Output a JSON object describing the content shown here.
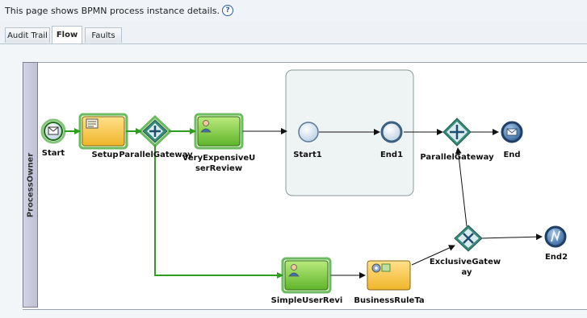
{
  "page": {
    "info_text": "This page shows BPMN process instance details.",
    "help_glyph": "?"
  },
  "tabs": [
    {
      "label": "Audit Trail"
    },
    {
      "label": "Flow"
    },
    {
      "label": "Faults"
    }
  ],
  "active_tab": "Flow",
  "lane": {
    "label": "ProcessOwner"
  },
  "nodes": {
    "start": "Start",
    "setup": "Setup",
    "parallel_gateway_1": "ParallelGateway",
    "very_expensive_line1": "VeryExpensiveU",
    "very_expensive_line2": "serReview",
    "start1": "Start1",
    "end1": "End1",
    "parallel_gateway_2": "ParallelGateway",
    "end": "End",
    "exclusive_line1": "ExclusiveGatew",
    "exclusive_line2": "ay",
    "end2": "End2",
    "simple_user_review": "SimpleUserRevi",
    "business_rule_task": "BusinessRuleTa"
  },
  "colors": {
    "active_path": "#2f9e1f",
    "task_green": "#8fd14f",
    "task_yellow": "#f6c542",
    "gateway_fill": "#3a8a7a",
    "event_fill": "#6aa0d0",
    "subprocess_fill": "#eef3f3"
  }
}
